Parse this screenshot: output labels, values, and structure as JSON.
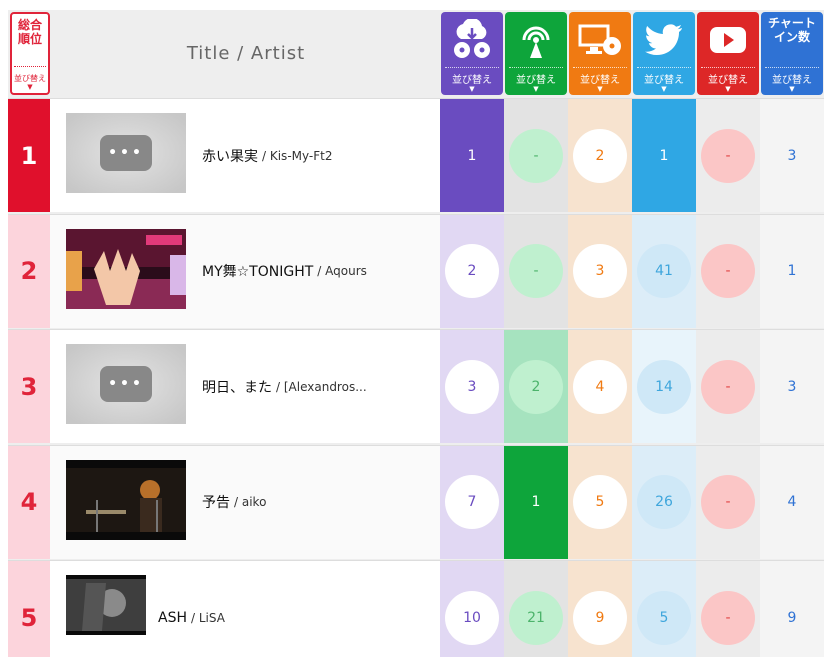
{
  "header": {
    "rank_label": "総合\n順位",
    "sort_label": "並び替え",
    "sort_arrow": "▼",
    "title_artist": "Title / Artist",
    "columns": [
      {
        "key": "download",
        "icon": "download-cd-icon",
        "color": "#6a4cc0",
        "label": ""
      },
      {
        "key": "radio",
        "icon": "radio-tower-icon",
        "color": "#0ea53b",
        "label": ""
      },
      {
        "key": "pc",
        "icon": "pc-cd-icon",
        "color": "#f07a12",
        "label": ""
      },
      {
        "key": "twitter",
        "icon": "twitter-bird-icon",
        "color": "#2fa7e4",
        "label": ""
      },
      {
        "key": "youtube",
        "icon": "youtube-play-icon",
        "color": "#dd2727",
        "label": ""
      },
      {
        "key": "chartin",
        "icon": "",
        "color": "#2f72d4",
        "label": "チャート\nイン数"
      }
    ]
  },
  "rows": [
    {
      "rank": "1",
      "title": "赤い果実",
      "artist": "/ Kis-My-Ft2",
      "thumb": "placeholder",
      "values": [
        "1",
        "-",
        "2",
        "1",
        "-",
        "3"
      ]
    },
    {
      "rank": "2",
      "title": "MY舞☆TONIGHT",
      "artist": "/ Aqours",
      "thumb": "anime",
      "values": [
        "2",
        "-",
        "3",
        "41",
        "-",
        "1"
      ]
    },
    {
      "rank": "3",
      "title": "明日、また",
      "artist": "/ [Alexandros...",
      "thumb": "placeholder",
      "values": [
        "3",
        "2",
        "4",
        "14",
        "-",
        "3"
      ]
    },
    {
      "rank": "4",
      "title": "予告",
      "artist": "/ aiko",
      "thumb": "concert",
      "values": [
        "7",
        "1",
        "5",
        "26",
        "-",
        "4"
      ]
    },
    {
      "rank": "5",
      "title": "ASH",
      "artist": "/ LiSA",
      "thumb": "portrait",
      "values": [
        "10",
        "21",
        "9",
        "5",
        "-",
        "9"
      ]
    }
  ],
  "thumb_dots": "•••",
  "colors": {
    "rank_red": "#e0102c",
    "rank_pink": "#fcd4dc",
    "download": "#6a4cc0",
    "radio": "#0ea53b",
    "pc": "#f07a12",
    "twitter": "#2fa7e4",
    "youtube": "#dd2727",
    "chartin": "#2f72d4"
  }
}
